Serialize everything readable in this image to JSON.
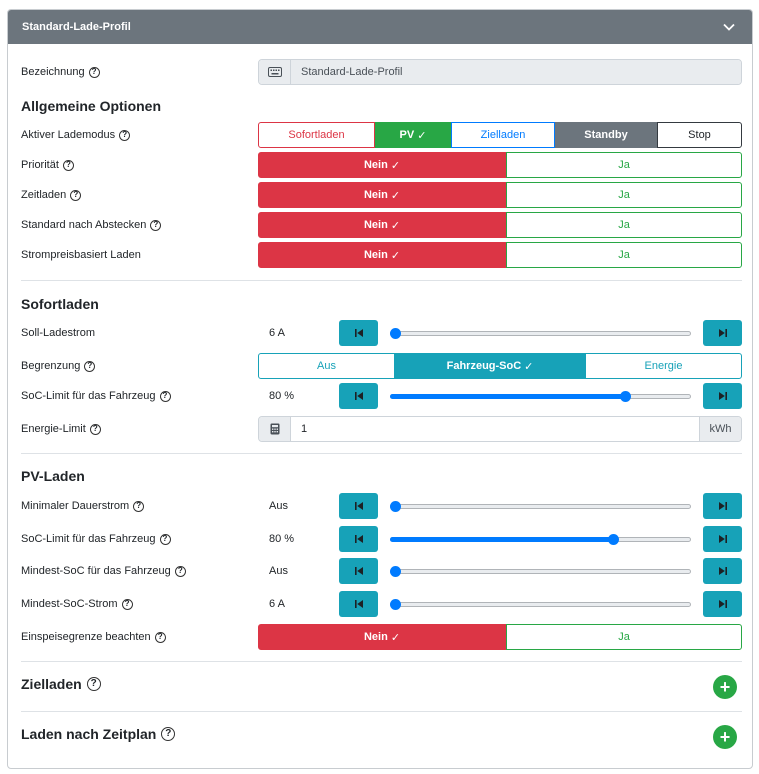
{
  "header": {
    "title": "Standard-Lade-Profil"
  },
  "colors": {
    "header_bg": "#6c757d",
    "danger": "#dc3545",
    "success": "#28a745",
    "info": "#17a2b8",
    "primary": "#007bff",
    "dark": "#343a40",
    "secondary": "#6c757d"
  },
  "bezeichnung": {
    "label": "Bezeichnung",
    "value": "Standard-Lade-Profil",
    "icon": "keyboard-icon"
  },
  "allgemein": {
    "title": "Allgemeine Optionen",
    "lademodus": {
      "label": "Aktiver Lademodus",
      "options": [
        "Sofortladen",
        "PV",
        "Zielladen",
        "Standby",
        "Stop"
      ],
      "selected": "PV"
    },
    "prioritaet": {
      "label": "Priorität",
      "no": "Nein",
      "yes": "Ja",
      "selected": "Nein"
    },
    "zeitladen": {
      "label": "Zeitladen",
      "no": "Nein",
      "yes": "Ja",
      "selected": "Nein"
    },
    "standard_nach_abstecken": {
      "label": "Standard nach Abstecken",
      "no": "Nein",
      "yes": "Ja",
      "selected": "Nein"
    },
    "strompreis": {
      "label": "Strompreisbasiert Laden",
      "no": "Nein",
      "yes": "Ja",
      "selected": "Nein"
    }
  },
  "sofortladen": {
    "title": "Sofortladen",
    "soll_ladestrom": {
      "label": "Soll-Ladestrom",
      "value": "6 A",
      "level": 0.0
    },
    "begrenzung": {
      "label": "Begrenzung",
      "options": [
        "Aus",
        "Fahrzeug-SoC",
        "Energie"
      ],
      "selected": "Fahrzeug-SoC"
    },
    "soc_limit": {
      "label": "SoC-Limit für das Fahrzeug",
      "value": "80 %",
      "level": 0.78
    },
    "energie_limit": {
      "label": "Energie-Limit",
      "value": "1",
      "unit": "kWh",
      "icon": "calculator-icon"
    }
  },
  "pv_laden": {
    "title": "PV-Laden",
    "min_dauerstrom": {
      "label": "Minimaler Dauerstrom",
      "value": "Aus",
      "level": 0.0
    },
    "soc_limit": {
      "label": "SoC-Limit für das Fahrzeug",
      "value": "80 %",
      "level": 0.74
    },
    "mindest_soc": {
      "label": "Mindest-SoC für das Fahrzeug",
      "value": "Aus",
      "level": 0.0
    },
    "mindest_soc_strom": {
      "label": "Mindest-SoC-Strom",
      "value": "6 A",
      "level": 0.0
    },
    "einspeisegrenze": {
      "label": "Einspeisegrenze beachten",
      "no": "Nein",
      "yes": "Ja",
      "selected": "Nein"
    }
  },
  "zielladen": {
    "title": "Zielladen"
  },
  "zeitplan": {
    "title": "Laden nach Zeitplan"
  },
  "check_mark": "✓",
  "help_mark": "?",
  "plus_mark": "+"
}
